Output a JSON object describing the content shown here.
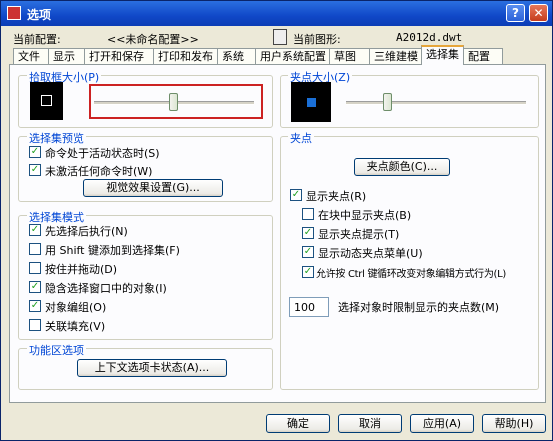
{
  "title": "选项",
  "header": {
    "current_profile_label": "当前配置:",
    "current_profile_value": "<<未命名配置>>",
    "current_drawing_label": "当前图形:",
    "current_drawing_value": "A2012d.dwt"
  },
  "tabs": [
    {
      "label": "文件"
    },
    {
      "label": "显示"
    },
    {
      "label": "打开和保存"
    },
    {
      "label": "打印和发布"
    },
    {
      "label": "系统"
    },
    {
      "label": "用户系统配置"
    },
    {
      "label": "草图"
    },
    {
      "label": "三维建模"
    },
    {
      "label": "选择集"
    },
    {
      "label": "配置"
    }
  ],
  "pickbox": {
    "label": "拾取框大小(P)",
    "level": 0.5
  },
  "preview": {
    "label": "选择集预览",
    "cmd_active": {
      "label": "命令处于活动状态时(S)",
      "checked": true
    },
    "no_cmd": {
      "label": "未激活任何命令时(W)",
      "checked": true
    },
    "visual_button": "视觉效果设置(G)..."
  },
  "modes": {
    "label": "选择集模式",
    "items": [
      {
        "label": "先选择后执行(N)",
        "checked": true
      },
      {
        "label": "用 Shift 键添加到选择集(F)",
        "checked": false
      },
      {
        "label": "按住并拖动(D)",
        "checked": false
      },
      {
        "label": "隐含选择窗口中的对象(I)",
        "checked": true
      },
      {
        "label": "对象编组(O)",
        "checked": true
      },
      {
        "label": "关联填充(V)",
        "checked": false
      }
    ]
  },
  "ribbon": {
    "label": "功能区选项",
    "button": "上下文选项卡状态(A)..."
  },
  "gripsize": {
    "label": "夹点大小(Z)",
    "level": 0.22
  },
  "grips": {
    "label": "夹点",
    "color_button": "夹点颜色(C)...",
    "items": [
      {
        "label": "显示夹点(R)",
        "checked": true
      },
      {
        "label": "在块中显示夹点(B)",
        "checked": false
      },
      {
        "label": "显示夹点提示(T)",
        "checked": true
      },
      {
        "label": "显示动态夹点菜单(U)",
        "checked": true
      },
      {
        "label": "允许按 Ctrl 键循环改变对象编辑方式行为(L)",
        "checked": true
      }
    ],
    "limit_value": "100",
    "limit_label": "选择对象时限制显示的夹点数(M)"
  },
  "footer": {
    "ok": "确定",
    "cancel": "取消",
    "apply": "应用(A)",
    "help": "帮助(H)"
  },
  "colors": {
    "highlight": "#cc2222",
    "grip_marker": "#1a6fd6"
  }
}
